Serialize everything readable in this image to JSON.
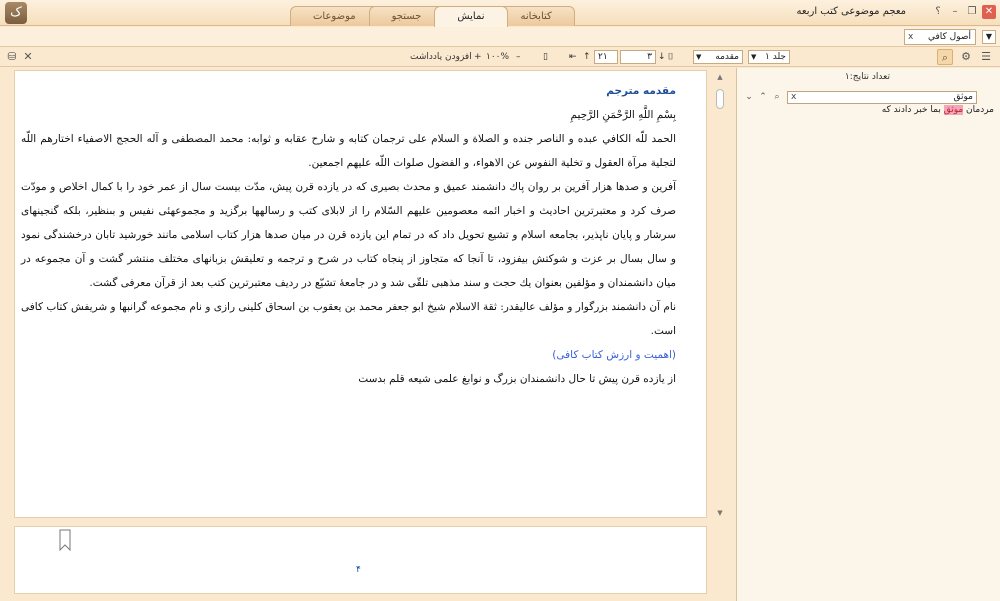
{
  "app": {
    "title": "معجم موضوعی کتب اربعه",
    "logo_glyph": "ک"
  },
  "window_controls": {
    "help": "؟",
    "minimize": "–",
    "restore": "❐",
    "close": "✕"
  },
  "tabs": [
    {
      "label": "موضوعات"
    },
    {
      "label": "جستجو"
    },
    {
      "label": "نمایش",
      "active": true
    },
    {
      "label": "کتابخانه"
    }
  ],
  "doc_tab": {
    "label": "أصول كافي",
    "close": "x"
  },
  "toolbar": {
    "zoom_value": "۱۰۰%",
    "add_note": "افزودن یادداشت",
    "page_current": "۳",
    "page_total": "۲۱",
    "section": "مقدمه",
    "volume": "جلد ۱"
  },
  "content": {
    "heading": "مقدمه مترجم",
    "basmala": "بِسْمِ اللَّهِ الرَّحْمَنِ الرَّحِيمِ",
    "p1": "الحمد للّه الكافي عبده و الناصر جنده و الصلاة و السلام على ترجمان كتابه و شارح عقابه و ثوابه: محمد المصطفى و آله الحجج الاصفياء اختارهم اللّه لتجلية مرآة العقول و تخلية النفوس عن الاهواء، و الفضول صلوات اللّه عليهم اجمعين.",
    "p2": "آفرين و صدها هزار آفرين بر روان پاك دانشمند عميق و محدث بصيرى كه در يازده قرن پيش، مدّت بيست سال از عمر خود را با كمال اخلاص و مودّت صرف كرد و معتبرترين احاديث و اخبار ائمه معصومين عليهم السّلام را از لابلاى كتب و رساله‏ها برگزيد و مجموعه‏ئى نفيس و بى‏نظير، بلكه گنجينه‏اى سرشار و پايان ناپذير، بجامعه اسلام و تشيع تحويل داد كه در تمام اين يازده قرن در ميان صدها هزار كتاب اسلامى مانند خورشيد تابان درخشندگى نمود و سال بسال بر عزت و شوكتش بيفزود، تا آنجا كه متجاوز از پنجاه كتاب در شرح و ترجمه و تعليقش بزبانهاى مختلف منتشر گشت و آن مجموعه در ميان دانشمندان و مؤلفين بعنوان يك حجت و سند مذهبى تلقّى شد و در جامعهٔ تشيّع در رديف معتبرترين كتب بعد از قرآن معرفى گشت.",
    "p3": "نام آن دانشمند بزرگوار و مؤلف عاليقدر: ثقة الاسلام شيخ ابو جعفر محمد بن يعقوب بن اسحاق كلينى رازى و نام مجموعه گرانبها و شريفش كتاب كافى است.",
    "subheading": "(اهميت و ارزش كتاب كافى)",
    "p4": "از يازده قرن پيش تا حال دانشمندان بزرگ و نوابغ علمى شيعه قلم بدست"
  },
  "page_number": "۴",
  "right_panel": {
    "result_count_label": "تعداد نتایج:۱",
    "search_value": "موثق",
    "clear": "x",
    "result_before": "مردمان ",
    "result_highlight": "موثق",
    "result_after": " بما خبر دادند كه"
  }
}
